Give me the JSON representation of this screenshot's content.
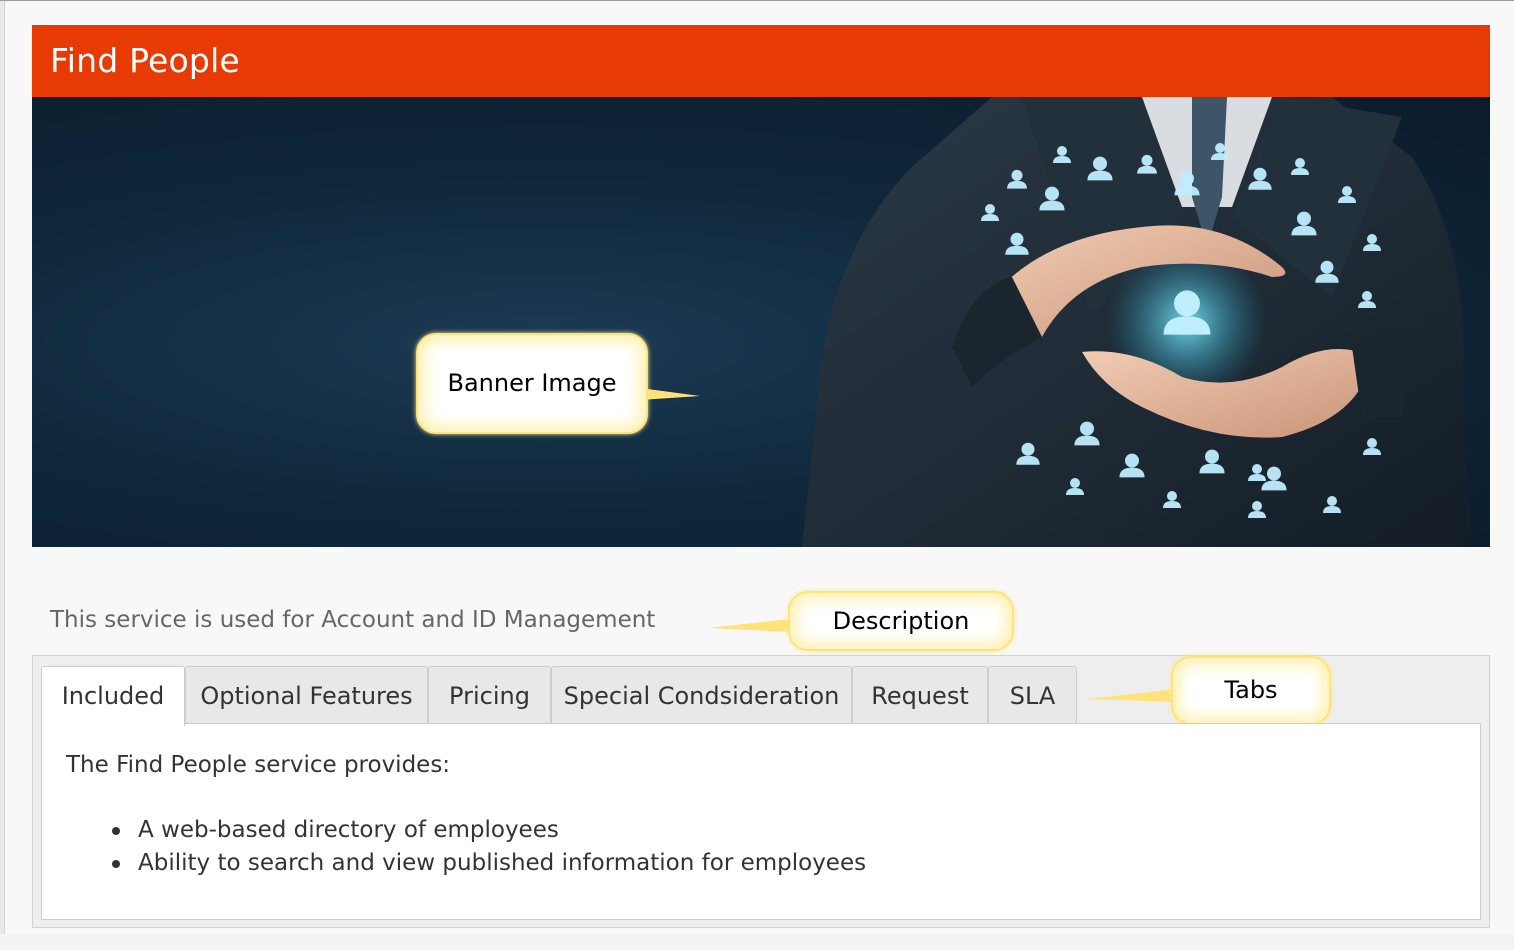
{
  "header": {
    "title": "Find People",
    "accent_color": "#e83a05"
  },
  "banner": {
    "icon": "people-network-image",
    "callout_label": "Banner Image"
  },
  "description": {
    "text": "This service is used for Account and ID Management",
    "callout_label": "Description"
  },
  "tabs": {
    "callout_label": "Tabs",
    "items": [
      {
        "label": "Included",
        "active": true
      },
      {
        "label": "Optional Features",
        "active": false
      },
      {
        "label": "Pricing",
        "active": false
      },
      {
        "label": "Special Condsideration",
        "active": false
      },
      {
        "label": "Request",
        "active": false
      },
      {
        "label": "SLA",
        "active": false
      }
    ]
  },
  "content": {
    "intro": "The Find People service provides:",
    "bullets": [
      "A web-based directory of employees",
      "Ability to search and view published information for employees"
    ]
  }
}
